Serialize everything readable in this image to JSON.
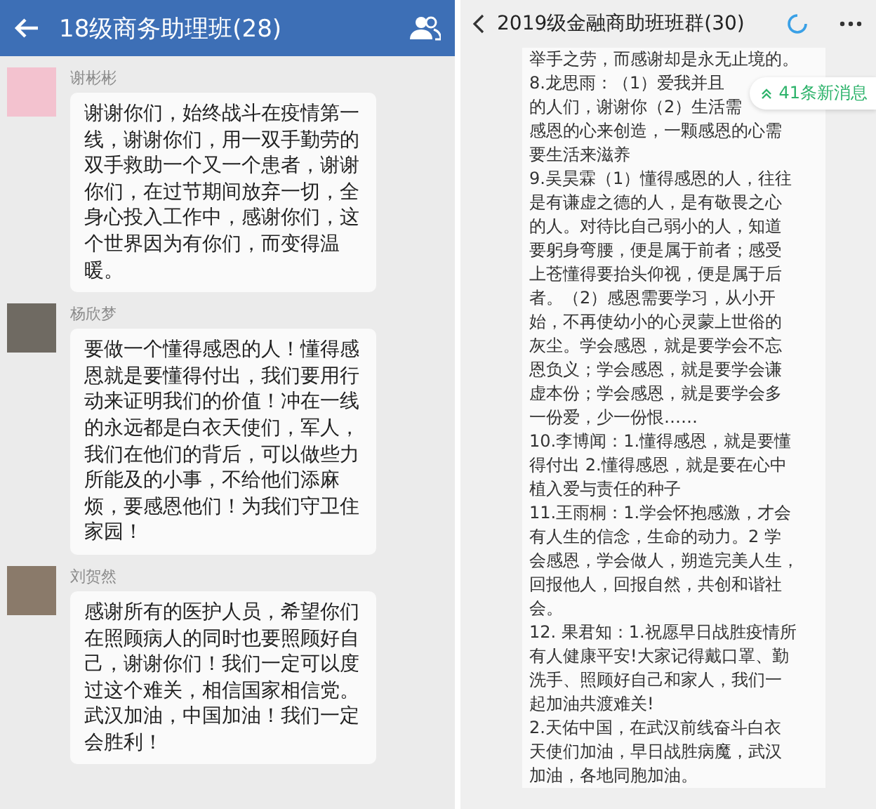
{
  "left_chat": {
    "title": "18级商务助理班(28)",
    "messages": [
      {
        "sender": "谢彬彬",
        "text": "谢谢你们，始终战斗在疫情第一线，谢谢你们，用一双手勤劳的双手救助一个又一个患者，谢谢你们，在过节期间放弃一切，全身心投入工作中，感谢你们，这个世界因为有你们，而变得温暖。"
      },
      {
        "sender": "杨欣梦",
        "text": "要做一个懂得感恩的人！懂得感恩就是要懂得付出，我们要用行动来证明我们的价值！冲在一线的永远都是白衣天使们，军人，我们在他们的背后，可以做些力所能及的小事，不给他们添麻烦，要感恩他们！为我们守卫住家园！"
      },
      {
        "sender": "刘贺然",
        "text": "感谢所有的医护人员，希望你们在照顾病人的同时也要照顾好自己，谢谢你们！我们一定可以度过这个难关，相信国家相信党。武汉加油，中国加油！我们一定会胜利！"
      }
    ]
  },
  "right_chat": {
    "title": "2019级金融商助班班群(30)",
    "new_messages_badge": "41条新消息",
    "message_lines": [
      "举手之劳，而感谢却是永无止境的。",
      "8.龙思雨：（1）爱我并且",
      "的人们，谢谢你（2）生活需",
      "感恩的心来创造，一颗感恩的心需",
      "要生活来滋养",
      "9.吴昊霖（1）懂得感恩的人，往往",
      "是有谦虚之德的人，是有敬畏之心",
      "的人。对待比自己弱小的人，知道",
      "要躬身弯腰，便是属于前者；感受",
      "上苍懂得要抬头仰视，便是属于后",
      "者。（2）感恩需要学习，从小开",
      "始，不再使幼小的心灵蒙上世俗的",
      "灰尘。学会感恩，就是要学会不忘",
      "恩负义；学会感恩，就是要学会谦",
      "虚本份；学会感恩，就是要学会多",
      "一份爱，少一份恨……",
      "10.李博闻：1.懂得感恩，就是要懂",
      "得付出 2.懂得感恩，就是要在心中",
      "植入爱与责任的种子",
      "11.王雨桐：1.学会怀抱感激，才会",
      "有人生的信念，生命的动力。2 学",
      "会感恩，学会做人，朔造完美人生，",
      "回报他人，回报自然，共创和谐社",
      "会。",
      "12. 果君知：1.祝愿早日战胜疫情所",
      "有人健康平安!大家记得戴口罩、勤",
      "洗手、照顾好自己和家人，我们一",
      "起加油共渡难关!",
      "2.天佑中国，在武汉前线奋斗白衣",
      "天使们加油，早日战胜病魔，武汉",
      "加油，各地同胞加油。"
    ]
  }
}
